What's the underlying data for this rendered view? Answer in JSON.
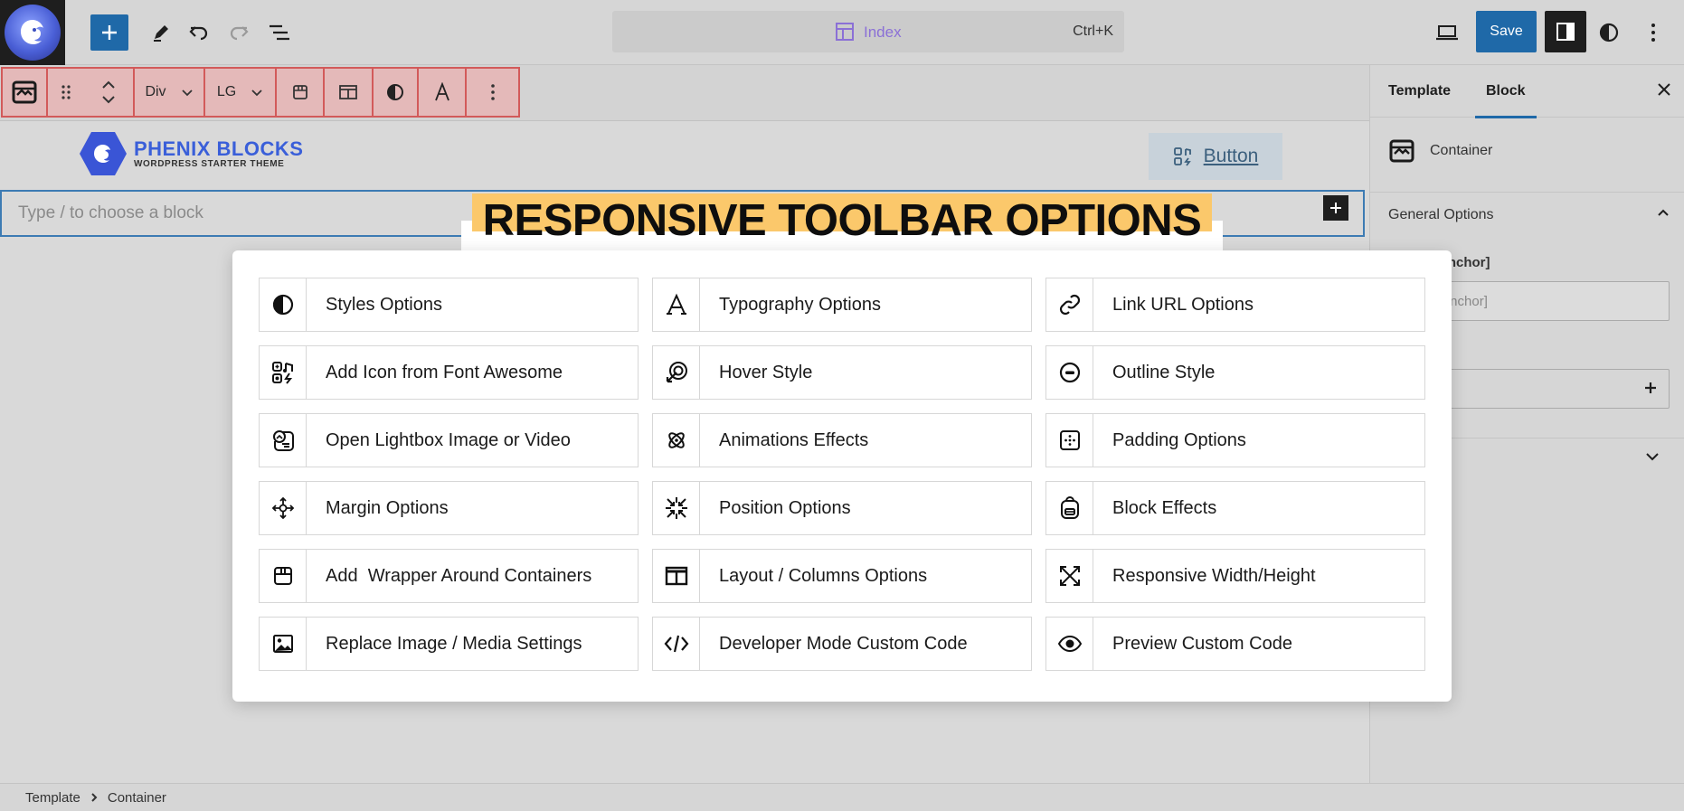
{
  "topbar": {
    "command_label": "Index",
    "command_shortcut": "Ctrl+K",
    "save_label": "Save"
  },
  "block_toolbar": {
    "tag_select": "Div",
    "size_select": "LG"
  },
  "canvas": {
    "brand_name": "PHENIX BLOCKS",
    "brand_tagline": "WORDPRESS STARTER THEME",
    "button_label": "Button",
    "appender_placeholder": "Type / to choose a block"
  },
  "heading": "RESPONSIVE TOOLBAR OPTIONS",
  "options": [
    {
      "label": "Styles Options",
      "icon": "half-circle-icon"
    },
    {
      "label": "Typography Options",
      "icon": "typography-icon"
    },
    {
      "label": "Link URL Options",
      "icon": "link-icon"
    },
    {
      "label": "Add Icon from Font Awesome",
      "icon": "icons-grid-icon"
    },
    {
      "label": "Hover Style",
      "icon": "hover-icon"
    },
    {
      "label": "Outline Style",
      "icon": "outline-icon"
    },
    {
      "label": "Open Lightbox Image or Video",
      "icon": "lightbox-icon"
    },
    {
      "label": "Animations Effects",
      "icon": "atom-icon"
    },
    {
      "label": "Padding Options",
      "icon": "padding-icon"
    },
    {
      "label": "Margin Options",
      "icon": "move-arrows-icon"
    },
    {
      "label": "Position Options",
      "icon": "position-icon"
    },
    {
      "label": "Block Effects",
      "icon": "backpack-icon"
    },
    {
      "label": "Add  Wrapper Around Containers",
      "icon": "wrapper-box-icon"
    },
    {
      "label": "Layout / Columns Options",
      "icon": "columns-icon"
    },
    {
      "label": "Responsive Width/Height",
      "icon": "resize-icon"
    },
    {
      "label": "Replace Image / Media Settings",
      "icon": "image-icon"
    },
    {
      "label": "Developer Mode Custom Code",
      "icon": "code-icon"
    },
    {
      "label": "Preview Custom Code",
      "icon": "eye-icon"
    }
  ],
  "panel": {
    "tabs": [
      "Template",
      "Block"
    ],
    "block_name": "Container",
    "general_options": "General Options",
    "anchor_label": "Anchor]",
    "anchor_placeholder": "[Anchor]",
    "advanced_label": "d"
  },
  "breadcrumb": [
    "Template",
    "Container"
  ],
  "colors": {
    "accent": "#1f69a8",
    "highlight": "#fbc86b",
    "toolbar_border": "#d25a5a",
    "brand": "#3a5fd9"
  }
}
